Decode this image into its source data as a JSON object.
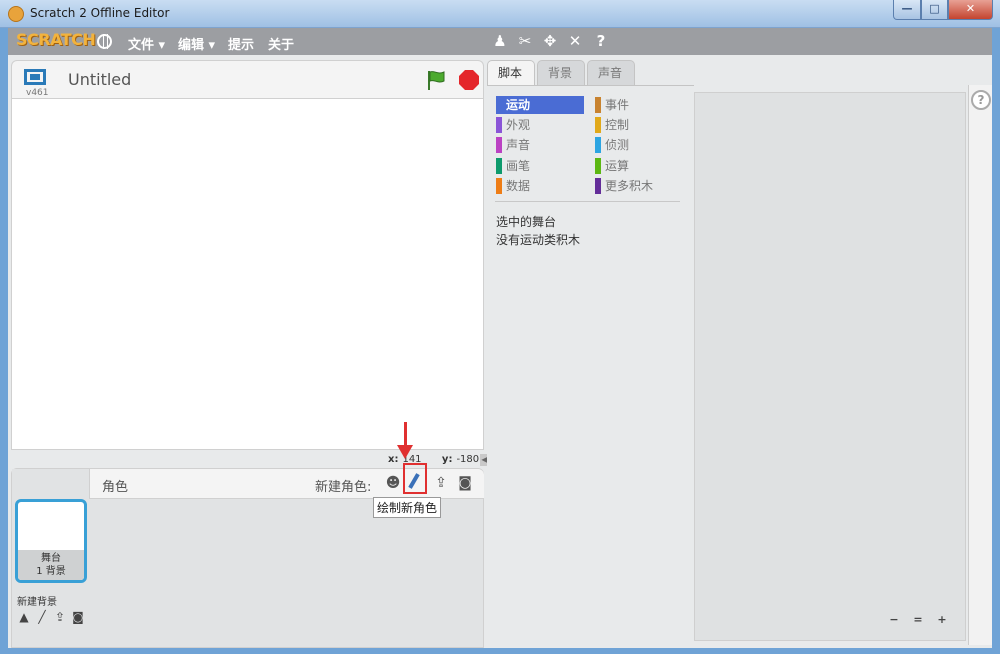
{
  "window": {
    "title": "Scratch 2 Offline Editor",
    "minimize": "—",
    "maximize": "□",
    "close": "✕"
  },
  "menubar": {
    "logo": "SCRATCH",
    "items": [
      "文件 ▾",
      "编辑 ▾",
      "提示",
      "关于"
    ],
    "tool_icons": [
      "duplicate-icon",
      "cut-icon",
      "grow-icon",
      "shrink-icon",
      "help-icon"
    ]
  },
  "stage": {
    "version": "v461",
    "project_title": "Untitled",
    "x_label": "x:",
    "x_value": "141",
    "y_label": "y:",
    "y_value": "-180"
  },
  "sprite_pane": {
    "sprites_label": "角色",
    "new_sprite_label": "新建角色:",
    "tooltip": "绘制新角色",
    "stage_name": "舞台",
    "stage_backdrops": "1 背景",
    "new_backdrop_label": "新建背景"
  },
  "tabs": [
    "脚本",
    "背景",
    "声音"
  ],
  "palette": {
    "categories": [
      {
        "label": "运动",
        "color": "#4a6cd4",
        "selected": true
      },
      {
        "label": "事件",
        "color": "#c88330"
      },
      {
        "label": "外观",
        "color": "#8a55d7"
      },
      {
        "label": "控制",
        "color": "#e1a91a"
      },
      {
        "label": "声音",
        "color": "#bb42c3"
      },
      {
        "label": "侦测",
        "color": "#2ca5e2"
      },
      {
        "label": "画笔",
        "color": "#0e9a6c"
      },
      {
        "label": "运算",
        "color": "#5cb712"
      },
      {
        "label": "数据",
        "color": "#ee7d16"
      },
      {
        "label": "更多积木",
        "color": "#632d99"
      }
    ],
    "message_line1": "选中的舞台",
    "message_line2": "没有运动类积木"
  },
  "scripts": {
    "zoom_out": "−",
    "zoom_reset": "=",
    "zoom_in": "+",
    "help": "?"
  }
}
